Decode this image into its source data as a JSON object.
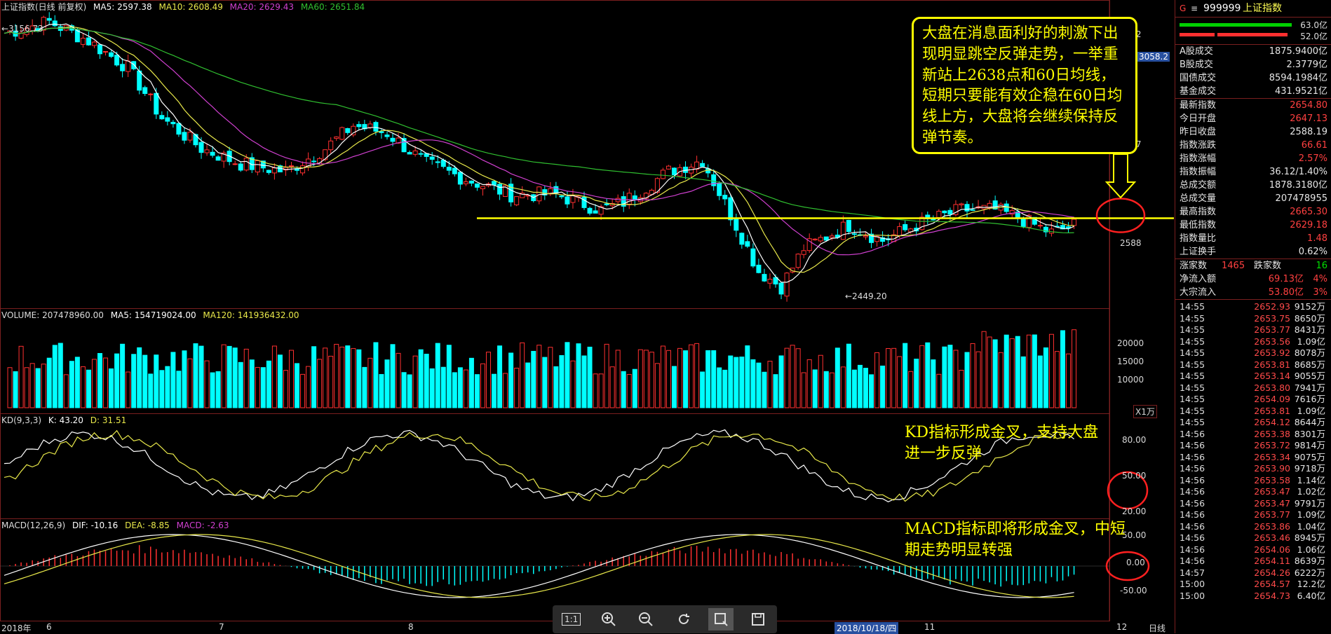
{
  "header": {
    "title": "上证指数(日线 前复权)",
    "ma5_label": "MA5: 2597.38",
    "ma10_label": "MA10: 2608.49",
    "ma20_label": "MA20: 2629.43",
    "ma60_label": "MA60: 2651.84",
    "volume_label": "VOLUME: 207478960.00",
    "vol_ma5_label": "MA5: 154719024.00",
    "vol_ma120_label": "MA120: 141936432.00",
    "kd_label": "KD(9,3,3)",
    "kd_k_label": "K: 43.20",
    "kd_d_label": "D: 31.51",
    "macd_label": "MACD(12,26,9)",
    "macd_dif_label": "DIF: -10.16",
    "macd_dea_label": "DEA: -8.85",
    "macd_val_label": "MACD: -2.63"
  },
  "axis": {
    "price_ticks": [
      "3132",
      "2847",
      "2588"
    ],
    "current_price_tag": "3058.2",
    "volume_ticks": [
      "20000",
      "15000",
      "10000"
    ],
    "volume_unit": "X1万",
    "kd_ticks": [
      "80.00",
      "50.00",
      "20.00"
    ],
    "macd_ticks": [
      "50.00",
      "0.00",
      "-50.00"
    ],
    "high_label": "3156.73",
    "low_label": "←2449.20",
    "date_labels": [
      "2018年",
      "6",
      "7",
      "8",
      "2018/10/18/四",
      "11",
      "12"
    ],
    "period_label": "日线"
  },
  "annotations": {
    "callout": "大盘在消息面利好的刺激下出现明显跳空反弹走势，一举重新站上2638点和60日均线，短期只要能有效企稳在60日均线上方，大盘将会继续保持反弹节奏。",
    "kd_note_line1": "KD指标形成金叉，支持大盘",
    "kd_note_line2": "进一步反弹",
    "macd_note_line1": "MACD指标即将形成金叉，中短",
    "macd_note_line2": "期走势明显转强"
  },
  "toolbar": {
    "buttons": [
      "1:1",
      "zoom-in",
      "zoom-out",
      "refresh",
      "crosshair",
      "save"
    ]
  },
  "side": {
    "code": "999999",
    "name": "上证指数",
    "bar_up_label": "63.0亿",
    "bar_down_label": "52.0亿",
    "stats": [
      {
        "k": "A股成交",
        "v": "1875.9400亿",
        "c": "wht"
      },
      {
        "k": "B股成交",
        "v": "2.3779亿",
        "c": "wht"
      },
      {
        "k": "国债成交",
        "v": "8594.1984亿",
        "c": "wht"
      },
      {
        "k": "基金成交",
        "v": "431.9521亿",
        "c": "wht"
      },
      {
        "k": "最新指数",
        "v": "2654.80",
        "c": "red"
      },
      {
        "k": "今日开盘",
        "v": "2647.13",
        "c": "red"
      },
      {
        "k": "昨日收盘",
        "v": "2588.19",
        "c": "wht"
      },
      {
        "k": "指数涨跌",
        "v": "66.61",
        "c": "red"
      },
      {
        "k": "指数涨幅",
        "v": "2.57%",
        "c": "red"
      },
      {
        "k": "指数振幅",
        "v": "36.12/1.40%",
        "c": "wht"
      },
      {
        "k": "总成交额",
        "v": "1878.3180亿",
        "c": "wht"
      },
      {
        "k": "总成交量",
        "v": "207478955",
        "c": "wht"
      },
      {
        "k": "最高指数",
        "v": "2665.30",
        "c": "red"
      },
      {
        "k": "最低指数",
        "v": "2629.18",
        "c": "red"
      },
      {
        "k": "指数量比",
        "v": "1.48",
        "c": "red"
      },
      {
        "k": "上证换手",
        "v": "0.62%",
        "c": "wht"
      }
    ],
    "up_count_label": "涨家数",
    "up_count": "1465",
    "down_count_label": "跌家数",
    "down_count": "16",
    "net_inflow_label": "净流入额",
    "net_inflow": "69.13亿",
    "net_inflow_pct": "4%",
    "block_inflow_label": "大宗流入",
    "block_inflow": "53.80亿",
    "block_inflow_pct": "3%",
    "ticks": [
      {
        "t": "14:55",
        "p": "2652.93",
        "q": "9152万"
      },
      {
        "t": "14:55",
        "p": "2653.75",
        "q": "8650万"
      },
      {
        "t": "14:55",
        "p": "2653.77",
        "q": "8431万"
      },
      {
        "t": "14:55",
        "p": "2653.56",
        "q": "1.09亿"
      },
      {
        "t": "14:55",
        "p": "2653.92",
        "q": "8078万"
      },
      {
        "t": "14:55",
        "p": "2653.81",
        "q": "8685万"
      },
      {
        "t": "14:55",
        "p": "2653.14",
        "q": "9055万"
      },
      {
        "t": "14:55",
        "p": "2653.80",
        "q": "7941万"
      },
      {
        "t": "14:55",
        "p": "2654.09",
        "q": "7616万"
      },
      {
        "t": "14:55",
        "p": "2653.81",
        "q": "1.09亿"
      },
      {
        "t": "14:55",
        "p": "2654.12",
        "q": "8644万"
      },
      {
        "t": "14:56",
        "p": "2653.38",
        "q": "8301万"
      },
      {
        "t": "14:56",
        "p": "2653.72",
        "q": "9814万"
      },
      {
        "t": "14:56",
        "p": "2653.34",
        "q": "9075万"
      },
      {
        "t": "14:56",
        "p": "2653.90",
        "q": "9718万"
      },
      {
        "t": "14:56",
        "p": "2653.58",
        "q": "1.14亿"
      },
      {
        "t": "14:56",
        "p": "2653.47",
        "q": "1.02亿"
      },
      {
        "t": "14:56",
        "p": "2653.47",
        "q": "9791万"
      },
      {
        "t": "14:56",
        "p": "2653.77",
        "q": "1.09亿"
      },
      {
        "t": "14:56",
        "p": "2653.86",
        "q": "1.04亿"
      },
      {
        "t": "14:56",
        "p": "2653.46",
        "q": "8945万"
      },
      {
        "t": "14:56",
        "p": "2654.06",
        "q": "1.06亿"
      },
      {
        "t": "14:56",
        "p": "2654.11",
        "q": "8639万"
      },
      {
        "t": "14:57",
        "p": "2654.26",
        "q": "6222万"
      },
      {
        "t": "15:00",
        "p": "2654.57",
        "q": "12.2亿"
      },
      {
        "t": "15:00",
        "p": "2654.73",
        "q": "6.40亿"
      }
    ]
  },
  "colors": {
    "up": "#ff3030",
    "down": "#00ffff",
    "ma5": "#ffffff",
    "ma10": "#e8e84a",
    "ma20": "#d040d0",
    "ma60": "#30c030",
    "annotation": "#ffff00"
  },
  "chart_data": {
    "type": "candlestick",
    "price_range": [
      2440,
      3170
    ],
    "support_level": 2638,
    "candles": [],
    "volume_series_note": "",
    "kd_k": [],
    "kd_d": []
  }
}
